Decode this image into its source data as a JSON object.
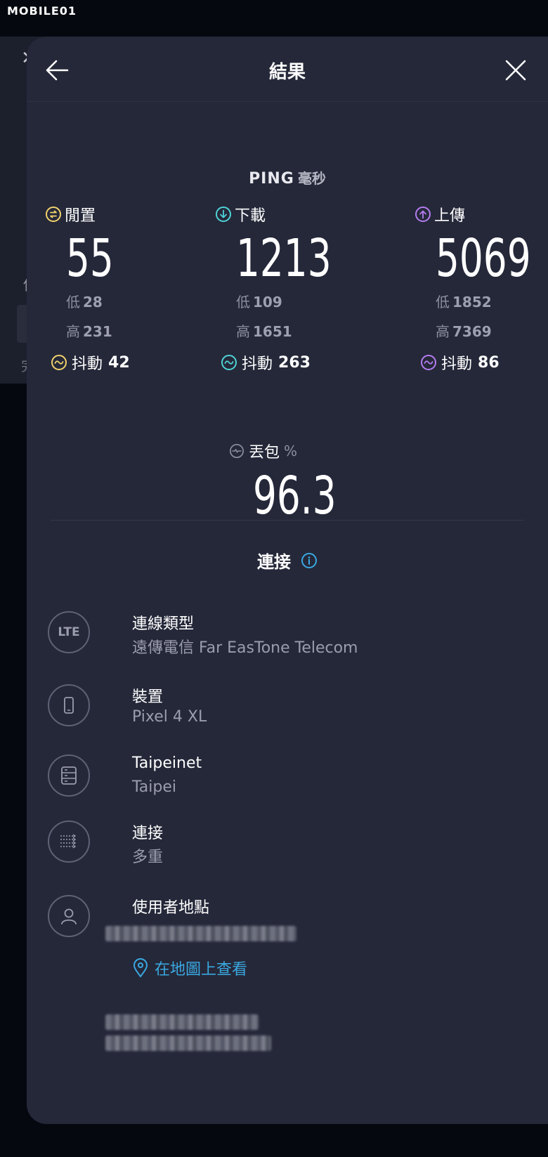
{
  "watermark": "MOBILE01",
  "header": {
    "title": "結果"
  },
  "ping": {
    "label": "PING",
    "unit": "毫秒"
  },
  "metrics": {
    "idle": {
      "label": "閒置",
      "value": "55",
      "low_label": "低",
      "low": "28",
      "high_label": "高",
      "high": "231",
      "jitter_label": "抖動",
      "jitter": "42",
      "color": "#f2d16b"
    },
    "download": {
      "label": "下載",
      "value": "1213",
      "low_label": "低",
      "low": "109",
      "high_label": "高",
      "high": "1651",
      "jitter_label": "抖動",
      "jitter": "263",
      "color": "#4fd3d6"
    },
    "upload": {
      "label": "上傳",
      "value": "5069",
      "low_label": "低",
      "low": "1852",
      "high_label": "高",
      "high": "7369",
      "jitter_label": "抖動",
      "jitter": "86",
      "color": "#b47cf0"
    }
  },
  "packet_loss": {
    "label": "丟包",
    "unit": "%",
    "value": "96.3"
  },
  "connection": {
    "heading": "連接",
    "rows": [
      {
        "icon": "lte-icon",
        "icon_text": "LTE",
        "title": "連線類型",
        "subtitle": "遠傳電信 Far EasTone Telecom"
      },
      {
        "icon": "phone-icon",
        "title": "裝置",
        "subtitle": "Pixel 4 XL"
      },
      {
        "icon": "server-icon",
        "title": "Taipeinet",
        "subtitle": "Taipei"
      },
      {
        "icon": "multi-connection-icon",
        "title": "連接",
        "subtitle": "多重"
      },
      {
        "icon": "user-icon",
        "title": "使用者地點",
        "subtitle": ""
      }
    ],
    "map_link": "在地圖上查看"
  },
  "colors": {
    "sheet_bg": "#252839",
    "accent_blue": "#3aa8e0"
  }
}
